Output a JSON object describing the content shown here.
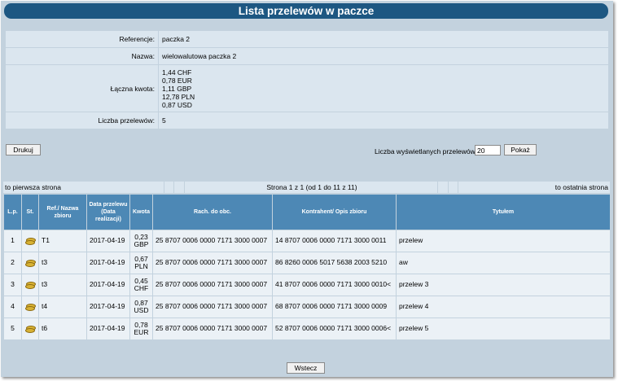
{
  "title": "Lista przelewów w paczce",
  "info": [
    {
      "label": "Referencje:",
      "lines": [
        "paczka 2"
      ]
    },
    {
      "label": "Nazwa:",
      "lines": [
        "wielowalutowa paczka 2"
      ]
    },
    {
      "label": "Łączna kwota:",
      "lines": [
        "1,44 CHF",
        "0,78 EUR",
        "1,11 GBP",
        "12,78 PLN",
        "0,87 USD"
      ]
    },
    {
      "label": "Liczba przelewów:",
      "lines": [
        "5"
      ]
    }
  ],
  "buttons": {
    "print": "Drukuj",
    "show": "Pokaż",
    "back": "Wstecz"
  },
  "count": {
    "label": "Liczba wyświetlanych przelewów:",
    "value": "20"
  },
  "pager": {
    "first": "to pierwsza strona",
    "status": "Strona 1 z 1 (od 1 do 11 z 11)",
    "last": "to ostatnia strona"
  },
  "columns": [
    "L.p.",
    "St.",
    "Ref./ Nazwa zbioru",
    "Data przelewu (Data realizacji)",
    "Kwota",
    "Rach. do obc.",
    "Kontrahent/ Opis zbioru",
    "Tytułem"
  ],
  "rows": [
    {
      "lp": "1",
      "ref": "T1",
      "date": "2017-04-19",
      "amount": "0,23",
      "currency": "GBP",
      "debit": "25 8707 0006 0000 7171 3000 0007",
      "contractor": "14 8707 0006 0000 7171 3000 0011",
      "title": "przelew"
    },
    {
      "lp": "2",
      "ref": "t3",
      "date": "2017-04-19",
      "amount": "0,67",
      "currency": "PLN",
      "debit": "25 8707 0006 0000 7171 3000 0007",
      "contractor": "86 8260 0006 5017 5638 2003 5210",
      "title": "aw"
    },
    {
      "lp": "3",
      "ref": "t3",
      "date": "2017-04-19",
      "amount": "0,45",
      "currency": "CHF",
      "debit": "25 8707 0006 0000 7171 3000 0007",
      "contractor": "41 8707 0006 0000 7171 3000 0010<",
      "title": "przelew 3"
    },
    {
      "lp": "4",
      "ref": "t4",
      "date": "2017-04-19",
      "amount": "0,87",
      "currency": "USD",
      "debit": "25 8707 0006 0000 7171 3000 0007",
      "contractor": "68 8707 0006 0000 7171 3000 0009",
      "title": "przelew 4"
    },
    {
      "lp": "5",
      "ref": "t6",
      "date": "2017-04-19",
      "amount": "0,78",
      "currency": "EUR",
      "debit": "25 8707 0006 0000 7171 3000 0007",
      "contractor": "52 8707 0006 0000 7171 3000 0006<",
      "title": "przelew 5"
    }
  ],
  "status_icon": "coins-icon",
  "colors": {
    "title_bar": "#1d5782",
    "header": "#4d88b5",
    "frame": "#c3d2de",
    "row": "#ebf1f6"
  }
}
